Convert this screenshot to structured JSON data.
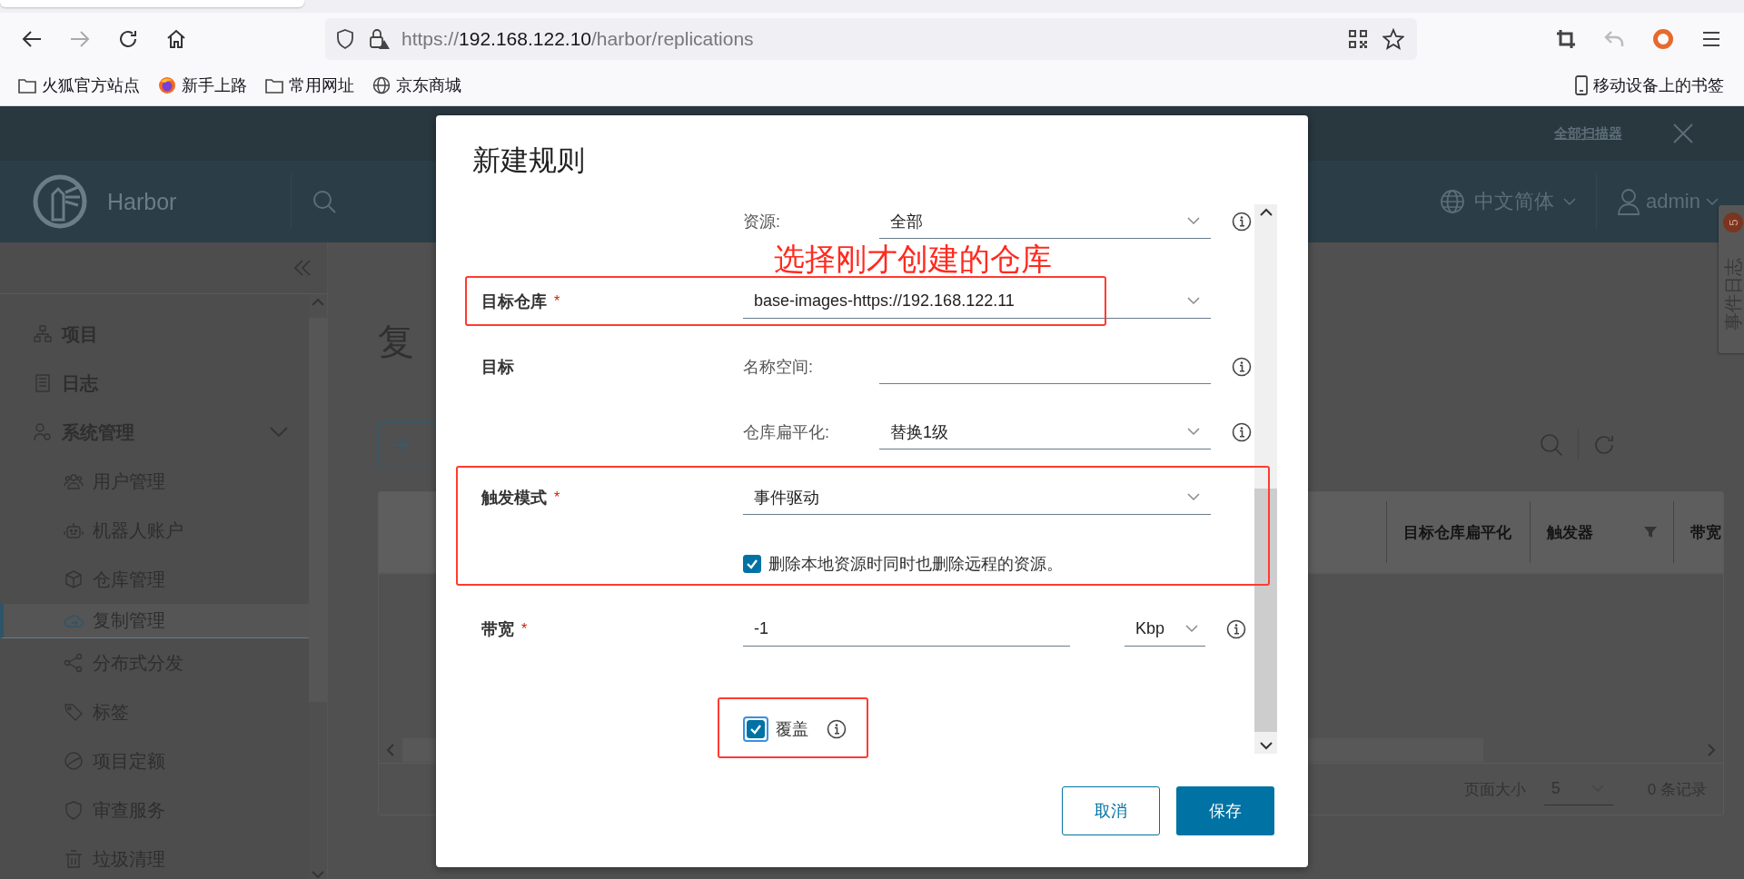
{
  "browser": {
    "url": {
      "scheme": "https://",
      "host": "192.168.122.10",
      "path": "/harbor/replications"
    },
    "bookmarks": [
      {
        "label": "火狐官方站点",
        "kind": "folder"
      },
      {
        "label": "新手上路",
        "kind": "firefox"
      },
      {
        "label": "常用网址",
        "kind": "folder"
      },
      {
        "label": "京东商城",
        "kind": "globe"
      }
    ],
    "mobile_bookmarks": "移动设备上的书签"
  },
  "harbor": {
    "banner_link": "全部扫描器",
    "brand": "Harbor",
    "language": "中文简体",
    "user": "admin",
    "sidebar": [
      {
        "label": "项目",
        "kind": "projects",
        "selected": false
      },
      {
        "label": "日志",
        "kind": "logs",
        "selected": false
      },
      {
        "label": "系统管理",
        "kind": "admin",
        "selected": false,
        "expanded": true,
        "children": [
          {
            "label": "用户管理",
            "kind": "users",
            "selected": false
          },
          {
            "label": "机器人账户",
            "kind": "robot",
            "selected": false
          },
          {
            "label": "仓库管理",
            "kind": "registry",
            "selected": false
          },
          {
            "label": "复制管理",
            "kind": "replication",
            "selected": true
          },
          {
            "label": "分布式分发",
            "kind": "share",
            "selected": false
          },
          {
            "label": "标签",
            "kind": "tag",
            "selected": false
          },
          {
            "label": "项目定额",
            "kind": "quota",
            "selected": false
          },
          {
            "label": "审查服务",
            "kind": "shield",
            "selected": false
          },
          {
            "label": "垃圾清理",
            "kind": "trash",
            "selected": false
          }
        ]
      }
    ],
    "page_title": "复",
    "table": {
      "columns": [
        {
          "label": "目标仓库扁平化",
          "filter": false
        },
        {
          "label": "触发器",
          "filter": true
        },
        {
          "label": "带宽",
          "filter": false
        }
      ],
      "footer": {
        "page_size_label": "页面大小",
        "page_size": "5",
        "record_count": "0 条记录"
      }
    },
    "event_log": {
      "label": "事件日志",
      "badge": "5"
    }
  },
  "dialog": {
    "title": "新建规则",
    "fields": [
      {
        "kind": "select",
        "sublabel": "资源:",
        "value": "全部",
        "info": true,
        "highlighted": false
      },
      {
        "kind": "note",
        "text": "选择刚才创建的仓库"
      },
      {
        "kind": "select",
        "label": "目标仓库",
        "required_mark": "*",
        "value": "base-images-https://192.168.122.11",
        "info": false,
        "highlighted": true
      },
      {
        "kind": "input",
        "label": "目标",
        "sublabel": "名称空间:",
        "info": true,
        "highlighted": false
      },
      {
        "kind": "select",
        "sublabel": "仓库扁平化:",
        "value": "替换1级",
        "info": true,
        "highlighted": false
      },
      {
        "kind": "select",
        "label": "触发模式",
        "required_mark": "*",
        "value": "事件驱动",
        "info": false,
        "highlighted": true,
        "option": {
          "label": "删除本地资源时同时也删除远程的资源。",
          "checked": true
        }
      },
      {
        "kind": "bandwidth",
        "label": "带宽",
        "required_mark": "*",
        "value": "-1",
        "unit": "Kbp",
        "info": true,
        "highlighted": false
      },
      {
        "kind": "checkbox",
        "label": "覆盖",
        "checked": true,
        "info": true,
        "highlighted": true
      }
    ],
    "buttons": [
      {
        "label": "取消",
        "kind": "secondary"
      },
      {
        "label": "保存",
        "kind": "primary"
      }
    ]
  }
}
